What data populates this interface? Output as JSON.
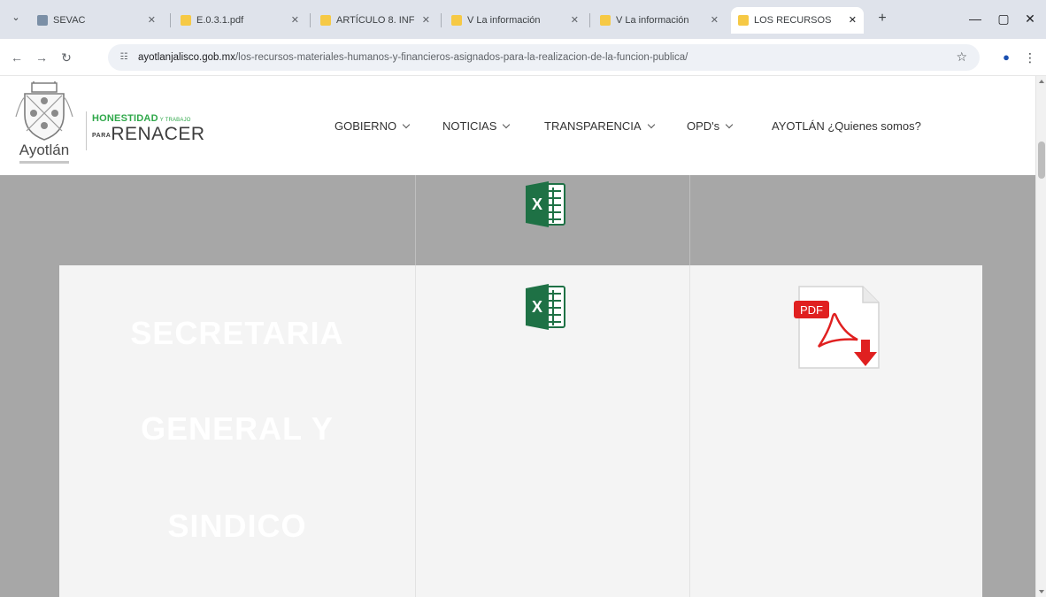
{
  "browser": {
    "tabs": [
      {
        "label": "SEVAC",
        "active": false
      },
      {
        "label": "E.0.3.1.pdf",
        "active": false
      },
      {
        "label": "ARTÍCULO 8. INF",
        "active": false
      },
      {
        "label": "V La información",
        "active": false
      },
      {
        "label": "V La información",
        "active": false
      },
      {
        "label": "LOS RECURSOS",
        "active": true
      }
    ],
    "url_host": "ayotlanjalisco.gob.mx",
    "url_path": "/los-recursos-materiales-humanos-y-financieros-asignados-para-la-realizacion-de-la-funcion-publica/"
  },
  "site": {
    "logo_name": "Ayotlán",
    "slogan_top": "HONESTIDAD",
    "slogan_top_small": "Y TRABAJO",
    "slogan_para": "PARA",
    "slogan_main": "RENACER",
    "nav": [
      {
        "label": "GOBIERNO",
        "dropdown": true
      },
      {
        "label": "NOTICIAS",
        "dropdown": true
      },
      {
        "label": "TRANSPARENCIA",
        "dropdown": true
      },
      {
        "label": "OPD's",
        "dropdown": true
      },
      {
        "label": "AYOTLÁN ¿Quienes somos?",
        "dropdown": false
      }
    ]
  },
  "content": {
    "row_title_lines": [
      "SECRETARIA",
      "GENERAL Y",
      "SINDICO"
    ],
    "pdf_badge": "PDF",
    "excel_letter": "X"
  },
  "colors": {
    "tab_strip": "#dfe3eb",
    "slogan_green": "#2fa84a",
    "excel_green": "#1e7145",
    "pdf_red": "#e02020",
    "content_gray": "#a7a7a7"
  }
}
